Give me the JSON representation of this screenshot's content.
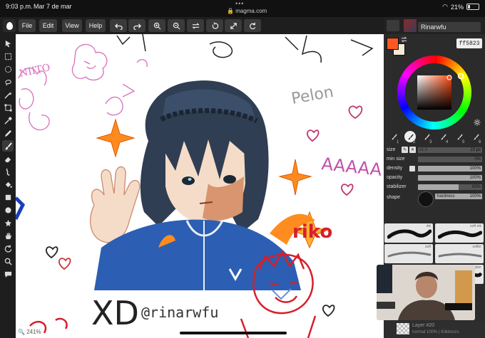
{
  "status_bar": {
    "time": "9:03 p.m.",
    "date": "Mar 7 de mar",
    "url": "magma.com",
    "battery": "21%"
  },
  "menu": {
    "file": "File",
    "edit": "Edit",
    "view": "View",
    "help": "Help"
  },
  "user": {
    "name": "Rinarwfu"
  },
  "color": {
    "hex": "ff5823",
    "primary": "#ff5823",
    "secondary": "#f3ead8"
  },
  "brushes": {
    "slots": [
      "1",
      "2",
      "3",
      "4",
      "5",
      "6"
    ],
    "active_index": 1
  },
  "brush_props": {
    "size_label": "size",
    "size_multiplier": "x1.0",
    "size_value": "23 px",
    "min_size_label": "min size",
    "min_size_value": "0%",
    "min_size_fraction": 0,
    "density_label": "density",
    "density_value": "100%",
    "density_fraction": 1.0,
    "opacity_label": "opacity",
    "opacity_value": "100%",
    "opacity_fraction": 1.0,
    "stabilizer_label": "stabilizer",
    "stabilizer_value": "63%",
    "stabilizer_fraction": 0.63,
    "shape_label": "shape",
    "hardness_label": "hardness",
    "hardness_value": "100%"
  },
  "presets": [
    {
      "name": "ink"
    },
    {
      "name": "soft ink"
    },
    {
      "name": "soft"
    },
    {
      "name": "softer"
    },
    {
      "name": "rough"
    },
    {
      "name": "rougher"
    }
  ],
  "layer": {
    "name": "Layer #20",
    "info": "normal 100% | Kiikitoozs"
  },
  "canvas": {
    "zoom": "241%",
    "signature": "@rinarwfu",
    "word_pelon": "Pelon",
    "word_aaaa": "AAAAA",
    "word_riko": "riko",
    "word_xd": "XD"
  }
}
